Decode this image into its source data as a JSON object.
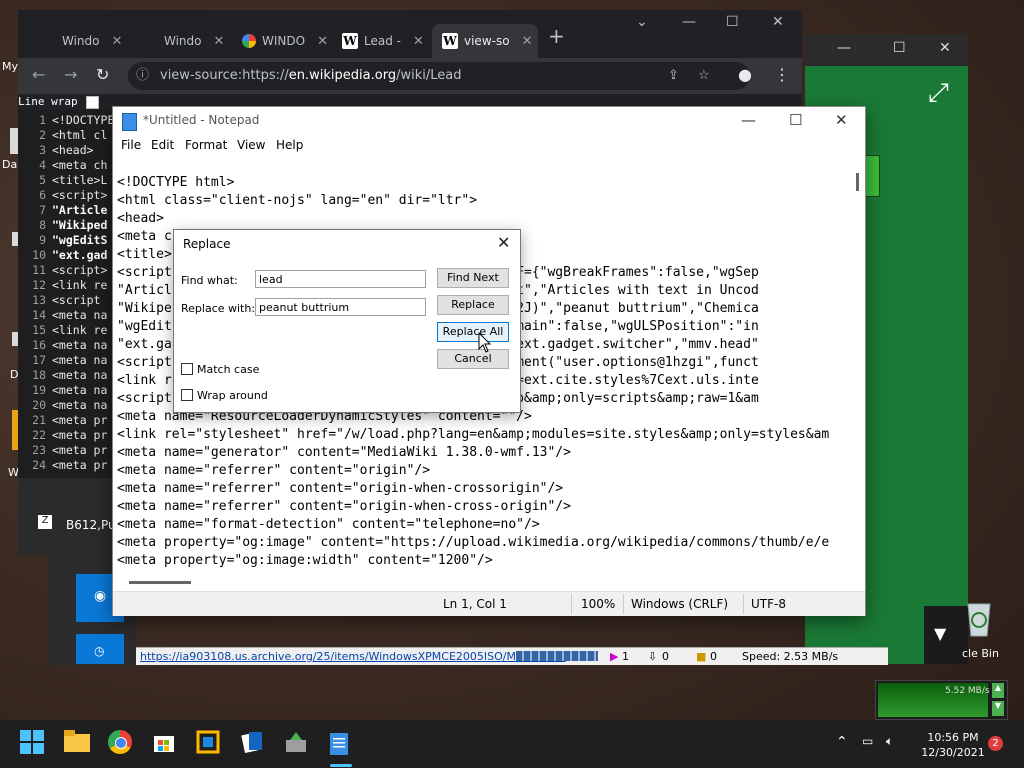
{
  "desktop": {
    "labels": [
      "My",
      "Da",
      "D",
      "W"
    ],
    "recycle_bin": "cle Bin"
  },
  "chrome": {
    "tabs": [
      {
        "title": "Windo",
        "icon": "none"
      },
      {
        "title": "Windo",
        "icon": "none"
      },
      {
        "title": "WINDO",
        "icon": "google-icon"
      },
      {
        "title": "Lead -",
        "icon": "wikipedia-icon"
      },
      {
        "title": "view-so",
        "icon": "wikipedia-icon"
      }
    ],
    "new_tab": "+",
    "url_prefix": "view-source:https://",
    "url_host": "en.wikipedia.org",
    "url_path": "/wiki/Lead",
    "line_wrap_label": "Line wrap",
    "source_lines": [
      {
        "n": "1",
        "t": "<!DOCTYPE",
        "bold": false
      },
      {
        "n": "2",
        "t": "<html cl",
        "bold": false
      },
      {
        "n": "3",
        "t": "<head>",
        "bold": false
      },
      {
        "n": "4",
        "t": "<meta ch",
        "bold": false
      },
      {
        "n": "5",
        "t": "<title>L",
        "bold": false
      },
      {
        "n": "6",
        "t": "<script>",
        "bold": false
      },
      {
        "n": "7",
        "t": "\"Article",
        "bold": true
      },
      {
        "n": "8",
        "t": "\"Wikiped",
        "bold": true
      },
      {
        "n": "9",
        "t": "\"wgEditS",
        "bold": true
      },
      {
        "n": "10",
        "t": "\"ext.gad",
        "bold": true
      },
      {
        "n": "11",
        "t": "<script>",
        "bold": false
      },
      {
        "n": "12",
        "t": "<link re",
        "bold": false
      },
      {
        "n": "13",
        "t": "<script",
        "bold": false
      },
      {
        "n": "14",
        "t": "<meta na",
        "bold": false
      },
      {
        "n": "15",
        "t": "<link re",
        "bold": false
      },
      {
        "n": "16",
        "t": "<meta na",
        "bold": false
      },
      {
        "n": "17",
        "t": "<meta na",
        "bold": false
      },
      {
        "n": "18",
        "t": "<meta na",
        "bold": false
      },
      {
        "n": "19",
        "t": "<meta na",
        "bold": false
      },
      {
        "n": "20",
        "t": "<meta na",
        "bold": false
      },
      {
        "n": "21",
        "t": "<meta pr",
        "bold": false
      },
      {
        "n": "22",
        "t": "<meta pr",
        "bold": false
      },
      {
        "n": "23",
        "t": "<meta pr",
        "bold": false
      },
      {
        "n": "24",
        "t": "<meta pr",
        "bold": false
      }
    ],
    "taskbar_item": "B612,Pu"
  },
  "download_bar": {
    "url": "https://ia903108.us.archive.org/25/items/WindowsXPMCE2005ISO/MCE2005S",
    "count1": "1",
    "count2": "0",
    "count3": "0",
    "speed": "Speed: 2.53 MB/s"
  },
  "notepad": {
    "title": "*Untitled - Notepad",
    "menu": [
      "File",
      "Edit",
      "Format",
      "View",
      "Help"
    ],
    "lines": [
      "<!DOCTYPE html>",
      "<html class=\"client-nojs\" lang=\"en\" dir=\"ltr\">",
      "<head>",
      "<meta c",
      "<title>",
      "<script                                  -js\";RLCONF={\"wgBreakFrames\":false,\"wgSep",
      "\"Articl                                  nguage text\",\"Articles with text in Uncod",
      "\"Wikipe                                  erature (W2J)\",\"peanut buttrium\",\"Chemica",
      "\"wgEdit                                  thMobileDomain\":false,\"wgULSPosition\":\"in",
      "\"ext.ga                                  Toolbar\",\"ext.gadget.switcher\",\"mmv.head\"",
      "<script                                  ader.implement(\"user.options@1hzgi\",funct",
      "<link r                                  mp;modules=ext.cite.styles%7Cext.uls.inte",
      "<script                                  les=startup&amp;only=scripts&amp;raw=1&am",
      "<meta name=\"ResourceLoaderDynamicStyles\" content=\"\"/>",
      "<link rel=\"stylesheet\" href=\"/w/load.php?lang=en&amp;modules=site.styles&amp;only=styles&am",
      "<meta name=\"generator\" content=\"MediaWiki 1.38.0-wmf.13\"/>",
      "<meta name=\"referrer\" content=\"origin\"/>",
      "<meta name=\"referrer\" content=\"origin-when-crossorigin\"/>",
      "<meta name=\"referrer\" content=\"origin-when-cross-origin\"/>",
      "<meta name=\"format-detection\" content=\"telephone=no\"/>",
      "<meta property=\"og:image\" content=\"https://upload.wikimedia.org/wikipedia/commons/thumb/e/e",
      "<meta property=\"og:image:width\" content=\"1200\"/>"
    ],
    "status": {
      "position": "Ln 1, Col 1",
      "zoom": "100%",
      "line_ending": "Windows (CRLF)",
      "encoding": "UTF-8"
    }
  },
  "replace_dialog": {
    "title": "Replace",
    "find_label": "Find what:",
    "find_value": "lead",
    "replace_label": "Replace with:",
    "replace_value": "peanut buttrium",
    "find_next": "Find Next",
    "replace": "Replace",
    "replace_all": "Replace All",
    "cancel": "Cancel",
    "match_case": "Match case",
    "wrap_around": "Wrap around"
  },
  "taskbar": {
    "time": "10:56 PM",
    "date": "12/30/2021",
    "notifications": "2",
    "meter_label": "5.52 MB/s"
  },
  "colors": {
    "accent": "#0078d7",
    "chrome_dark": "#202124",
    "taskbar": "#1f1f1f"
  }
}
